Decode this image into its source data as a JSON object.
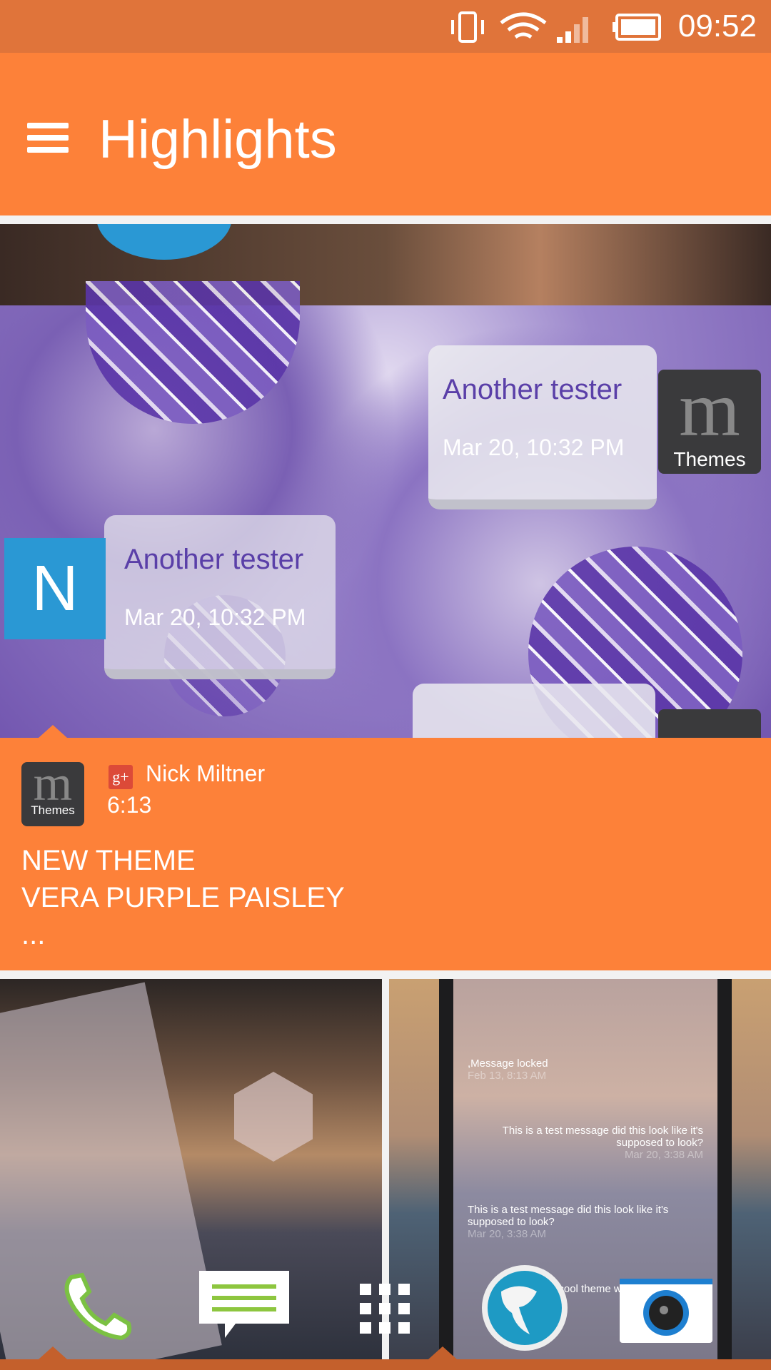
{
  "status_bar": {
    "time": "09:52",
    "icons": [
      "vibrate-icon",
      "wifi-icon",
      "signal-icon",
      "battery-icon"
    ]
  },
  "app_bar": {
    "title": "Highlights",
    "menu_icon": "hamburger-menu-icon"
  },
  "feature": {
    "bubbles": [
      {
        "name": "Another tester",
        "date": "Mar 20, 10:32 PM"
      },
      {
        "name": "Another tester",
        "date": "Mar 20, 10:32 PM"
      }
    ],
    "logo_text": "Themes",
    "n_letter": "N",
    "m_letter": "m"
  },
  "card": {
    "source_logo_text": "Themes",
    "source": "google-plus",
    "gplus_label": "g+",
    "author": "Nick Miltner",
    "time": "6:13",
    "lines": [
      "NEW THEME",
      "VERA PURPLE PAISLEY",
      "..."
    ]
  },
  "tile_right": {
    "messages": [
      {
        "text": ",Message locked",
        "date": "Feb 13, 8:13 AM"
      },
      {
        "text": "This is a test message did this look like it's supposed to look?",
        "date": "Mar 20, 3:38 AM"
      },
      {
        "text": "This is a test message did this look like it's supposed to look?",
        "date": "Mar 20, 3:38 AM"
      },
      {
        "text": "This is a cool theme what do you think?",
        "date": ""
      }
    ]
  },
  "dock": [
    {
      "name": "Phone"
    },
    {
      "name": "Messages"
    },
    {
      "name": "All apps"
    },
    {
      "name": "Internet"
    },
    {
      "name": "Camera"
    }
  ],
  "colors": {
    "accent": "#fd8139",
    "status_bar": "#e0743a"
  }
}
